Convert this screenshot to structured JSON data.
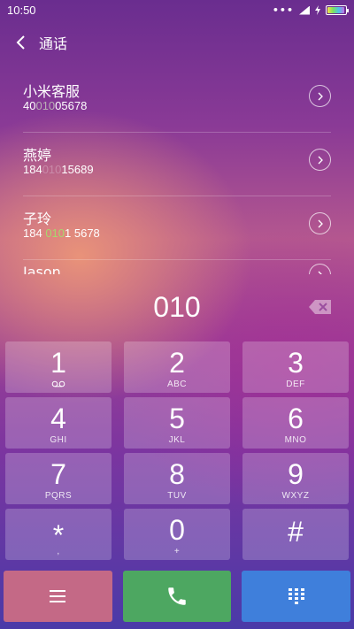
{
  "status_bar": {
    "time": "10:50",
    "dots": "•••"
  },
  "header": {
    "title": "通话"
  },
  "contacts": [
    {
      "name": "小米客服",
      "num_pre": "40",
      "num_hl": "010",
      "num_post": "05678"
    },
    {
      "name": "燕婷",
      "num_pre": "184",
      "num_hl": "010",
      "num_post": "15689"
    },
    {
      "name": "子玲",
      "num_pre": "184 ",
      "num_hl": "010",
      "num_post": "1 5678"
    },
    {
      "name": "Jason"
    }
  ],
  "dialer": {
    "number": "010"
  },
  "keypad": [
    {
      "digit": "1",
      "letters": ""
    },
    {
      "digit": "2",
      "letters": "ABC"
    },
    {
      "digit": "3",
      "letters": "DEF"
    },
    {
      "digit": "4",
      "letters": "GHI"
    },
    {
      "digit": "5",
      "letters": "JKL"
    },
    {
      "digit": "6",
      "letters": "MNO"
    },
    {
      "digit": "7",
      "letters": "PQRS"
    },
    {
      "digit": "8",
      "letters": "TUV"
    },
    {
      "digit": "9",
      "letters": "WXYZ"
    },
    {
      "digit": "*",
      "letters": ","
    },
    {
      "digit": "0",
      "letters": "+"
    },
    {
      "digit": "#",
      "letters": ""
    }
  ],
  "icons": {
    "key_1_sub": "voicemail-icon",
    "menu": "menu-icon",
    "call": "phone-icon",
    "keypad_toggle": "dialpad-icon"
  },
  "colors": {
    "menu_button": "#c46986",
    "call_button": "#4da761",
    "keypad_button": "#3f7fdb",
    "highlight_green": "#a6d86e"
  }
}
